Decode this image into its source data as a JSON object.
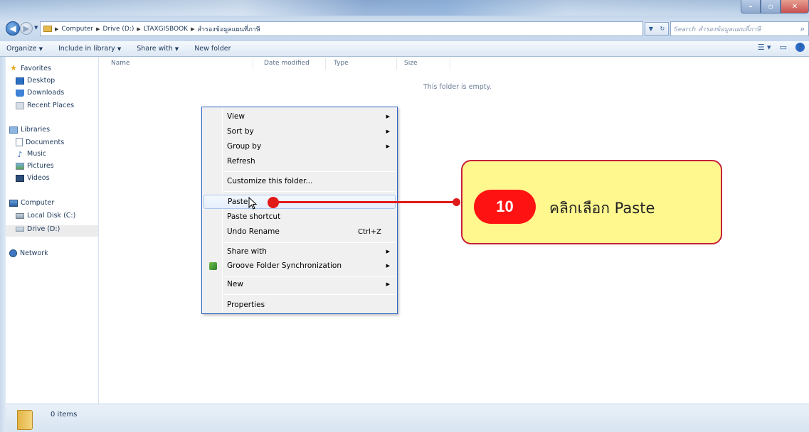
{
  "window": {
    "minimize_glyph": "–",
    "maximize_glyph": "▫",
    "close_glyph": "✕"
  },
  "address_bar": {
    "crumbs": [
      "Computer",
      "Drive (D:)",
      "LTAXGISBOOK",
      "สำรองข้อมูลแผนที่ภาษี"
    ],
    "search_placeholder": "Search สำรองข้อมูลแผนที่ภาษี"
  },
  "toolbar": {
    "organize": "Organize",
    "include_in_library": "Include in library",
    "share_with": "Share with",
    "new_folder": "New folder"
  },
  "nav_pane": {
    "favorites": "Favorites",
    "desktop": "Desktop",
    "downloads": "Downloads",
    "recent_places": "Recent Places",
    "libraries": "Libraries",
    "documents": "Documents",
    "music": "Music",
    "pictures": "Pictures",
    "videos": "Videos",
    "computer": "Computer",
    "local_disk": "Local Disk (C:)",
    "drive_d": "Drive (D:)",
    "network": "Network"
  },
  "columns": {
    "name": "Name",
    "date_modified": "Date modified",
    "type": "Type",
    "size": "Size"
  },
  "empty_message": "This folder is empty.",
  "context_menu": {
    "view": "View",
    "sort_by": "Sort by",
    "group_by": "Group by",
    "refresh": "Refresh",
    "customize": "Customize this folder...",
    "paste": "Paste",
    "paste_shortcut": "Paste shortcut",
    "undo_rename": "Undo Rename",
    "undo_shortcut": "Ctrl+Z",
    "share_with": "Share with",
    "groove": "Groove Folder Synchronization",
    "new": "New",
    "properties": "Properties"
  },
  "annotation": {
    "step_number": "10",
    "text": "คลิกเลือก  Paste",
    "color": "#e11a1a",
    "box_color": "#fff88f"
  },
  "status_bar": {
    "item_count": "0 items"
  }
}
